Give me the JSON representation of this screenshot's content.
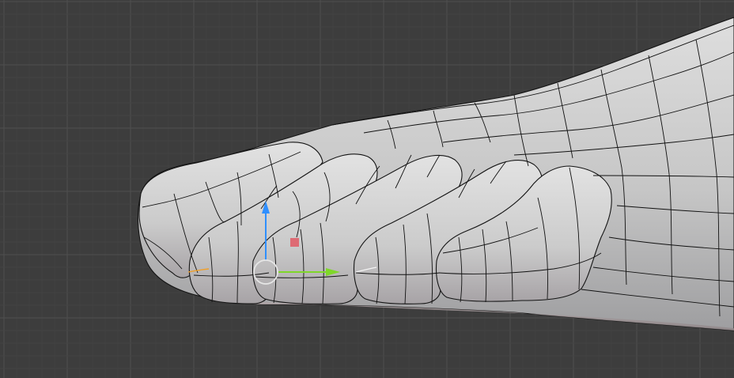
{
  "viewport": {
    "background_color": "#3d3d3d",
    "grid_minor_color": "#444444",
    "grid_major_color": "#4c4c4c",
    "mesh_color": "#cfcfcf",
    "wire_color": "#111111"
  },
  "gizmo": {
    "x_axis_color": "#7fd62a",
    "y_axis_color": "#2f8fff",
    "z_handle_color": "#e0606a",
    "pivot_color": "#e6e6e6",
    "edge_highlight_color": "#f0a02a"
  },
  "icons": {
    "pivot": "circle-pivot-icon",
    "x_arrow": "arrow-right-icon",
    "y_arrow": "arrow-up-icon",
    "plane_handle": "square-handle-icon"
  }
}
